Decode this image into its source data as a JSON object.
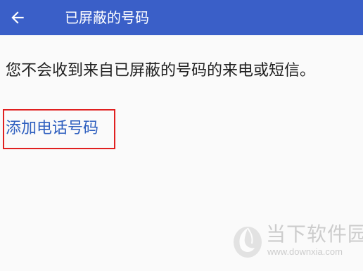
{
  "colors": {
    "appbar": "#3a5fc8",
    "link": "#2e5fbf",
    "highlight_box": "#e02020",
    "background": "#fafafa"
  },
  "appbar": {
    "back_icon": "arrow-left-icon",
    "title": "已屏蔽的号码"
  },
  "content": {
    "info_text": "您不会收到来自已屏蔽的号码的来电或短信。",
    "add_number_label": "添加电话号码"
  },
  "watermark": {
    "logo_icon": "downxia-logo-icon",
    "name": "当下软件园",
    "url": "www.downxia.com"
  }
}
